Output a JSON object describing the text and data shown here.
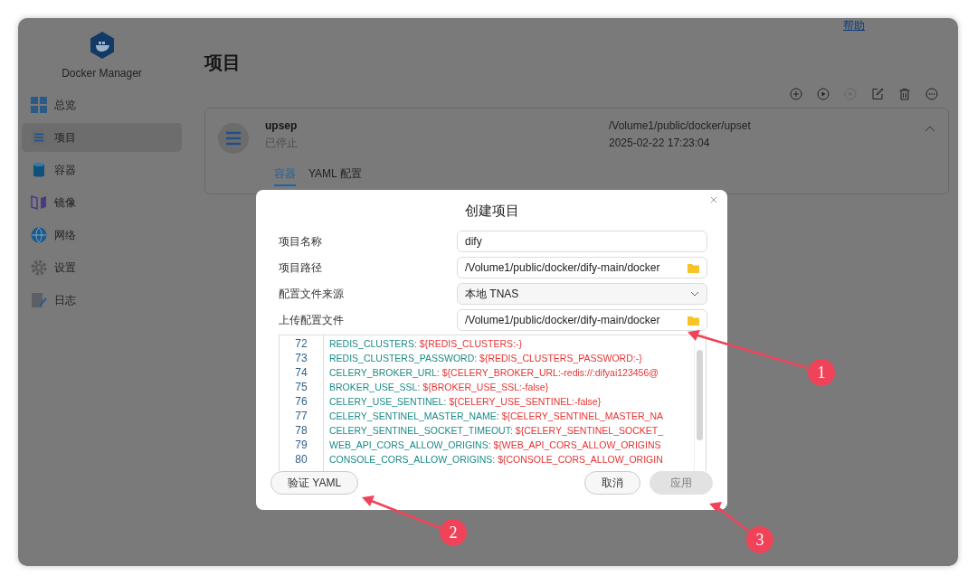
{
  "app": {
    "name": "Docker Manager",
    "help_link": "帮助"
  },
  "sidebar": {
    "items": [
      {
        "label": "总览",
        "selected": false
      },
      {
        "label": "项目",
        "selected": true
      },
      {
        "label": "容器",
        "selected": false
      },
      {
        "label": "镜像",
        "selected": false
      },
      {
        "label": "网络",
        "selected": false
      },
      {
        "label": "设置",
        "selected": false
      },
      {
        "label": "日志",
        "selected": false
      }
    ]
  },
  "page": {
    "title": "项目",
    "toolbar": [
      {
        "disabled": false
      },
      {
        "disabled": false
      },
      {
        "disabled": true
      },
      {
        "disabled": false
      },
      {
        "disabled": false
      },
      {
        "disabled": false
      }
    ]
  },
  "project": {
    "name": "upsep",
    "status": "已停止",
    "path": "/Volume1/public/docker/upset",
    "time": "2025-02-22 17:23:04",
    "expanded": true,
    "tabs": [
      {
        "label": "容器",
        "selected": true
      },
      {
        "label": "YAML 配置",
        "selected": false
      }
    ]
  },
  "dialog": {
    "title": "创建项目",
    "fields": [
      {
        "label": "项目名称",
        "kind": "text",
        "value": "dify"
      },
      {
        "label": "项目路径",
        "kind": "folder",
        "value": "/Volume1/public/docker/dify-main/docker"
      },
      {
        "label": "配置文件来源",
        "kind": "select",
        "value": "本地 TNAS"
      },
      {
        "label": "上传配置文件",
        "kind": "folder",
        "value": "/Volume1/public/docker/dify-main/docker"
      }
    ],
    "code": [
      {
        "line": "72",
        "key": "REDIS_CLUSTERS:",
        "value": "${REDIS_CLUSTERS:-}"
      },
      {
        "line": "73",
        "key": "REDIS_CLUSTERS_PASSWORD:",
        "value": "${REDIS_CLUSTERS_PASSWORD:-}"
      },
      {
        "line": "74",
        "key": "CELERY_BROKER_URL:",
        "value": "${CELERY_BROKER_URL:-redis://:difyai123456@"
      },
      {
        "line": "75",
        "key": "BROKER_USE_SSL:",
        "value": "${BROKER_USE_SSL:-false}"
      },
      {
        "line": "76",
        "key": "CELERY_USE_SENTINEL:",
        "value": "${CELERY_USE_SENTINEL:-false}"
      },
      {
        "line": "77",
        "key": "CELERY_SENTINEL_MASTER_NAME:",
        "value": "${CELERY_SENTINEL_MASTER_NA"
      },
      {
        "line": "78",
        "key": "CELERY_SENTINEL_SOCKET_TIMEOUT:",
        "value": "${CELERY_SENTINEL_SOCKET_"
      },
      {
        "line": "79",
        "key": "WEB_API_CORS_ALLOW_ORIGINS:",
        "value": "${WEB_API_CORS_ALLOW_ORIGINS"
      },
      {
        "line": "80",
        "key": "CONSOLE_CORS_ALLOW_ORIGINS:",
        "value": "${CONSOLE_CORS_ALLOW_ORIGIN"
      }
    ],
    "buttons": [
      {
        "label": "验证 YAML",
        "kind": "validate",
        "disabled": false
      },
      {
        "label": "取消",
        "kind": "cancel",
        "disabled": false
      },
      {
        "label": "应用",
        "kind": "apply",
        "disabled": true
      }
    ]
  },
  "annotations": [
    {
      "number": "1"
    },
    {
      "number": "2"
    },
    {
      "number": "3"
    }
  ]
}
